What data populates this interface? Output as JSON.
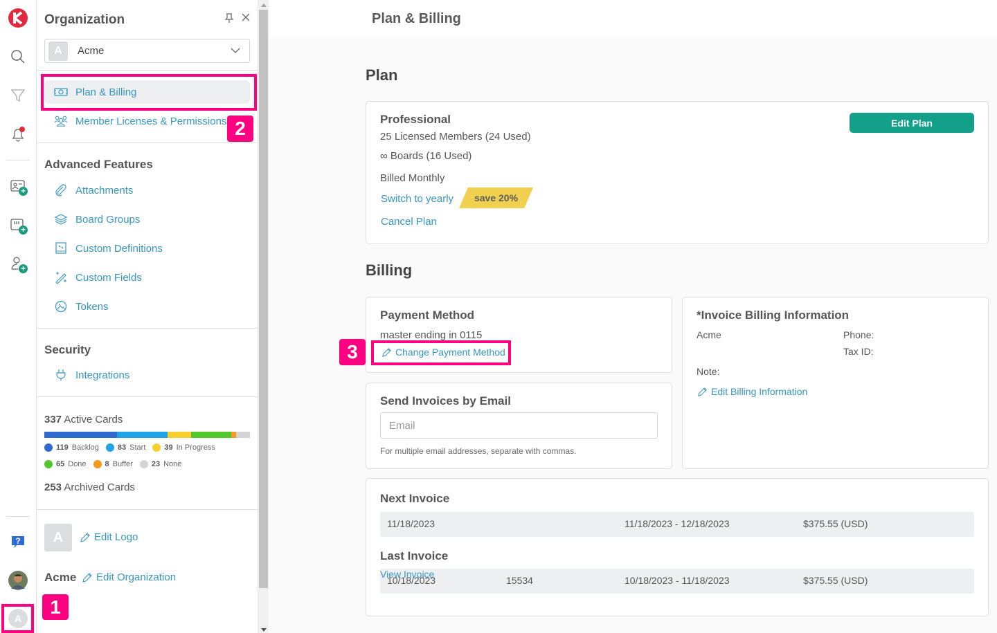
{
  "rail": {
    "icons": [
      "kanban-logo-icon",
      "search-icon",
      "filter-icon",
      "notification-bell-icon",
      "add-card-icon",
      "add-board-icon",
      "add-user-icon",
      "help-icon",
      "user-avatar",
      "organization-avatar"
    ],
    "org_avatar_letter": "A",
    "colors": {
      "logo": "#e5283e",
      "notification": "#e5283e",
      "plus_badge": "#1a9a80"
    }
  },
  "panel": {
    "title": "Organization",
    "org_select": {
      "avatar_letter": "A",
      "value": "Acme"
    },
    "org_nav": [
      {
        "label": "Plan & Billing",
        "icon": "money-bill-icon",
        "active": true
      },
      {
        "label": "Member Licenses & Permissions",
        "icon": "users-icon",
        "active": false
      }
    ],
    "advanced_title": "Advanced Features",
    "advanced_items": [
      {
        "label": "Attachments",
        "icon": "paperclip-icon"
      },
      {
        "label": "Board Groups",
        "icon": "layers-icon"
      },
      {
        "label": "Custom Definitions",
        "icon": "book-icon"
      },
      {
        "label": "Custom Fields",
        "icon": "magic-wand-icon"
      },
      {
        "label": "Tokens",
        "icon": "image-circle-icon"
      }
    ],
    "security_title": "Security",
    "security_items": [
      {
        "label": "Integrations",
        "icon": "plug-icon"
      }
    ],
    "active_cards": {
      "count": "337",
      "label": "Active Cards"
    },
    "card_breakdown": [
      {
        "count": 119,
        "label": "Backlog",
        "color": "#2f6ad0"
      },
      {
        "count": 83,
        "label": "Start",
        "color": "#1ea3e6"
      },
      {
        "count": 39,
        "label": "In Progress",
        "color": "#f8cf2e"
      },
      {
        "count": 65,
        "label": "Done",
        "color": "#52c72a"
      },
      {
        "count": 8,
        "label": "Buffer",
        "color": "#f59a1c"
      },
      {
        "count": 23,
        "label": "None",
        "color": "#d4d4d4"
      }
    ],
    "archived_cards": {
      "count": "253",
      "label": "Archived Cards"
    },
    "logo_letter": "A",
    "edit_logo": "Edit Logo",
    "org_name": "Acme",
    "edit_org": "Edit Organization"
  },
  "header": {
    "title": "Plan & Billing"
  },
  "plan": {
    "section_title": "Plan",
    "name": "Professional",
    "members": "25 Licensed Members (24 Used)",
    "boards": "∞ Boards (16 Used)",
    "billing_cycle": "Billed Monthly",
    "switch_link": "Switch to yearly",
    "save_badge": "save 20%",
    "cancel_link": "Cancel Plan",
    "edit_button": "Edit Plan"
  },
  "billing": {
    "section_title": "Billing",
    "payment": {
      "title": "Payment Method",
      "card": "master ending in 0115",
      "change_link": "Change Payment Method"
    },
    "invoice_info": {
      "title": "*Invoice Billing Information",
      "company": "Acme",
      "phone_label": "Phone:",
      "tax_label": "Tax ID:",
      "note_label": "Note:",
      "edit_link": "Edit Billing Information"
    },
    "email": {
      "title": "Send Invoices by Email",
      "placeholder": "Email",
      "value": "",
      "help": "For multiple email addresses, separate with commas."
    },
    "next_invoice": {
      "title": "Next Invoice",
      "date": "11/18/2023",
      "number": "",
      "period": "11/18/2023 - 12/18/2023",
      "amount": "$375.55 (USD)"
    },
    "last_invoice": {
      "title": "Last Invoice",
      "date": "10/18/2023",
      "number": "15534",
      "period": "10/18/2023 - 11/18/2023",
      "amount": "$375.55 (USD)",
      "view_link": "View Invoice"
    }
  },
  "annotations": [
    {
      "number": "1",
      "target": "organization-avatar"
    },
    {
      "number": "2",
      "target": "Plan & Billing"
    },
    {
      "number": "3",
      "target": "Change Payment Method"
    }
  ],
  "colors": {
    "accent_link": "#3597c2",
    "primary_button": "#13a08a",
    "annotation": "#ff0080",
    "save_badge": "#f2d04f"
  }
}
